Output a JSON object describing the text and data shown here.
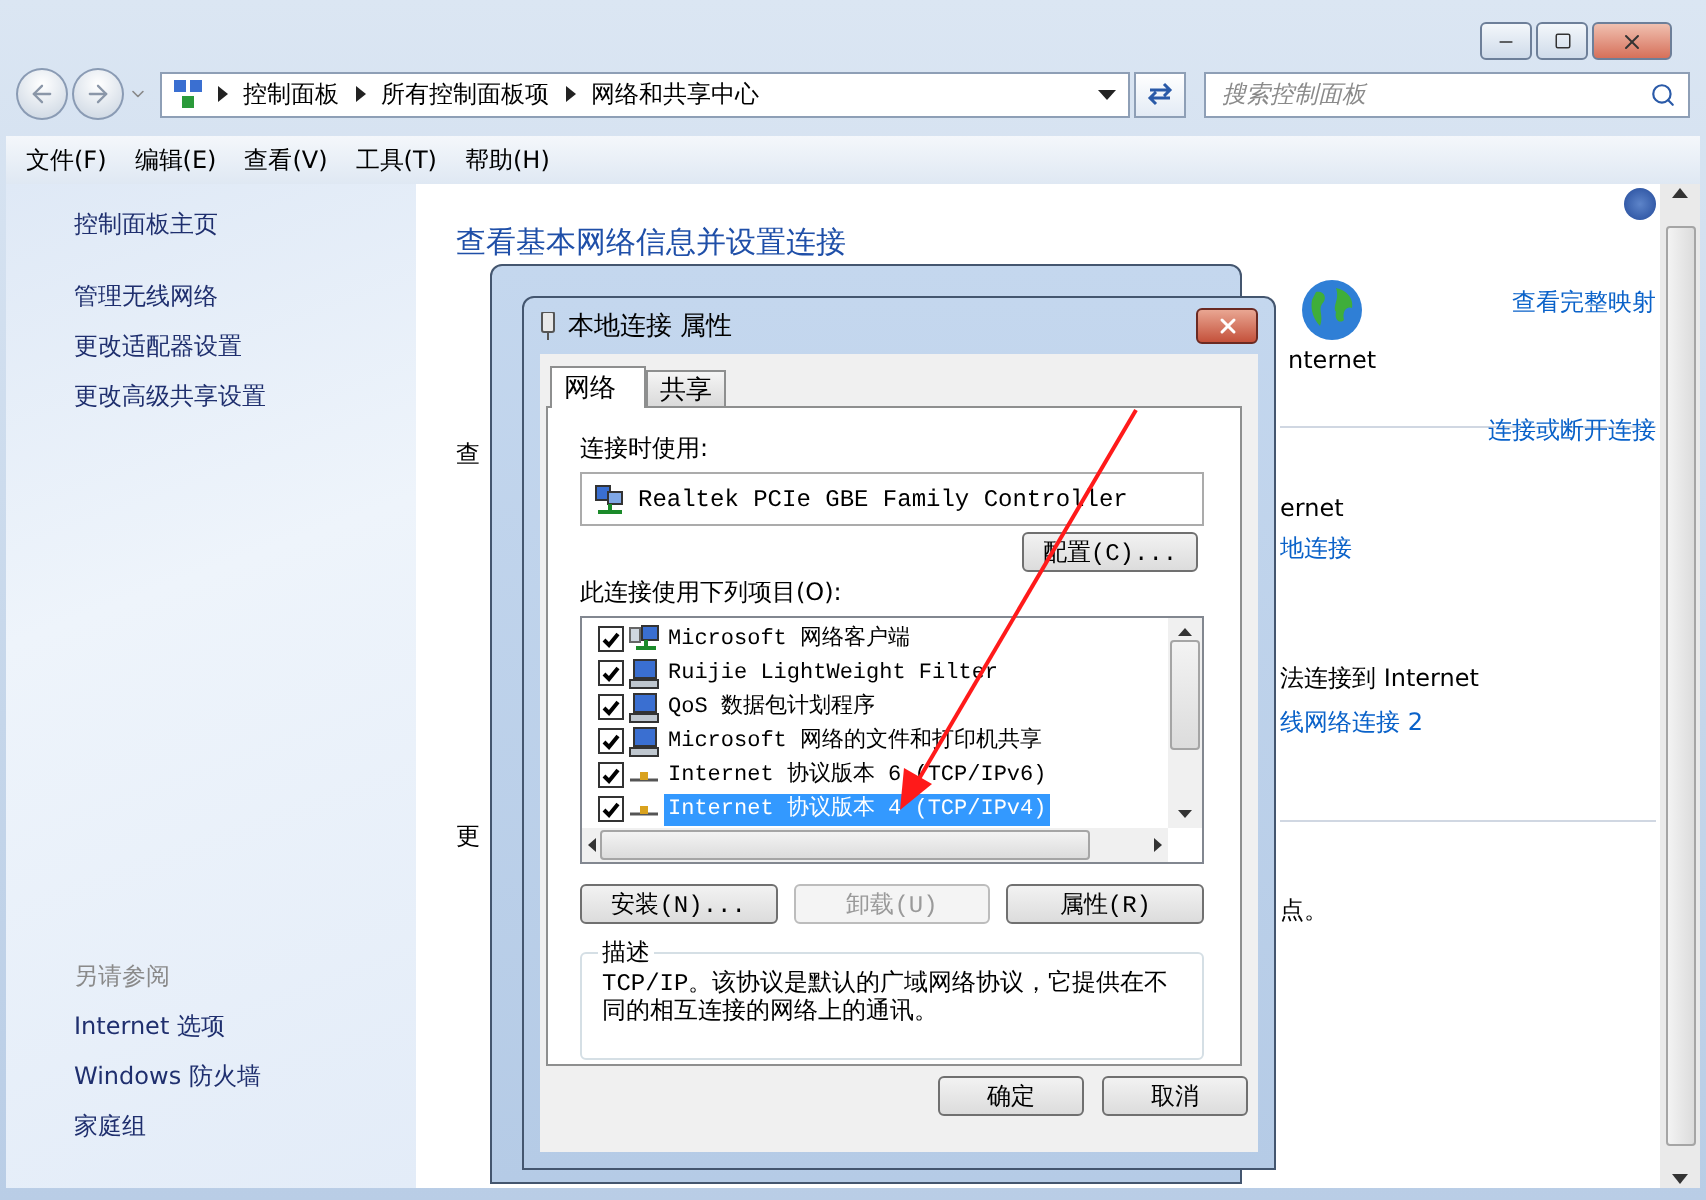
{
  "window": {
    "breadcrumbs": [
      "控制面板",
      "所有控制面板项",
      "网络和共享中心"
    ],
    "search": {
      "placeholder": "搜索控制面板"
    }
  },
  "menu": [
    "文件(F)",
    "编辑(E)",
    "查看(V)",
    "工具(T)",
    "帮助(H)"
  ],
  "sidebar": {
    "links": [
      "控制面板主页",
      "管理无线网络",
      "更改适配器设置",
      "更改高级共享设置"
    ],
    "see_also": {
      "title": "另请参阅",
      "links": [
        "Internet 选项",
        "Windows 防火墙",
        "家庭组"
      ]
    }
  },
  "content": {
    "heading": "查看基本网络信息并设置连接",
    "map_link": "查看完整映射",
    "internet_label": "nternet",
    "left_fragments": [
      "查",
      "更"
    ],
    "connect_link": "连接或断开连接",
    "network_1": {
      "text": "ernet",
      "link": "地连接"
    },
    "network_2": {
      "text": "法连接到 Internet",
      "link": "线网络连接 2"
    },
    "bottom_fragment": "点。"
  },
  "dialog": {
    "title": "本地连接 属性",
    "tabs": [
      {
        "label": "网络",
        "selected": true
      },
      {
        "label": "共享",
        "selected": false
      }
    ],
    "connect_using_label": "连接时使用:",
    "adapter": "Realtek PCIe GBE Family Controller",
    "configure_button": "配置(C)...",
    "items_label": "此连接使用下列项目(O):",
    "items": [
      {
        "kind": "client",
        "label": "Microsoft 网络客户端",
        "checked": true,
        "selected": false
      },
      {
        "kind": "service",
        "label": "Ruijie LightWeight Filter",
        "checked": true,
        "selected": false
      },
      {
        "kind": "service",
        "label": "QoS 数据包计划程序",
        "checked": true,
        "selected": false
      },
      {
        "kind": "service",
        "label": "Microsoft 网络的文件和打印机共享",
        "checked": true,
        "selected": false
      },
      {
        "kind": "protocol",
        "label": "Internet 协议版本 6 (TCP/IPv6)",
        "checked": true,
        "selected": false
      },
      {
        "kind": "protocol",
        "label": "Internet 协议版本 4 (TCP/IPv4)",
        "checked": true,
        "selected": true
      }
    ],
    "action_buttons": [
      {
        "label": "安装(N)...",
        "disabled": false
      },
      {
        "label": "卸载(U)",
        "disabled": true
      },
      {
        "label": "属性(R)",
        "disabled": false
      }
    ],
    "description": {
      "title": "描述",
      "text": "TCP/IP。该协议是默认的广域网络协议，它提供在不同的相互连接的网络上的通讯。"
    },
    "footer_buttons": [
      "确定",
      "取消"
    ]
  }
}
